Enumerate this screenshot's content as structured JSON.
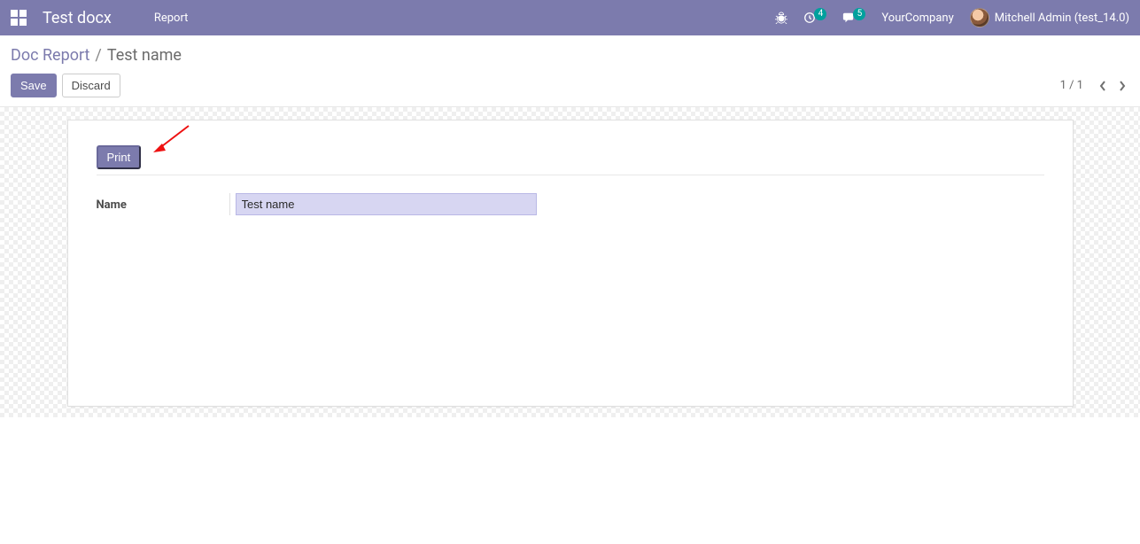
{
  "header": {
    "app_title": "Test docx",
    "menu": {
      "report": "Report"
    },
    "activity_count": "4",
    "discuss_count": "5",
    "company": "YourCompany",
    "user": "Mitchell Admin (test_14.0)"
  },
  "breadcrumb": {
    "root": "Doc Report",
    "sep": "/",
    "current": "Test name"
  },
  "controls": {
    "save": "Save",
    "discard": "Discard",
    "pager": "1 / 1"
  },
  "form": {
    "print_label": "Print",
    "name_label": "Name",
    "name_value": "Test name"
  }
}
